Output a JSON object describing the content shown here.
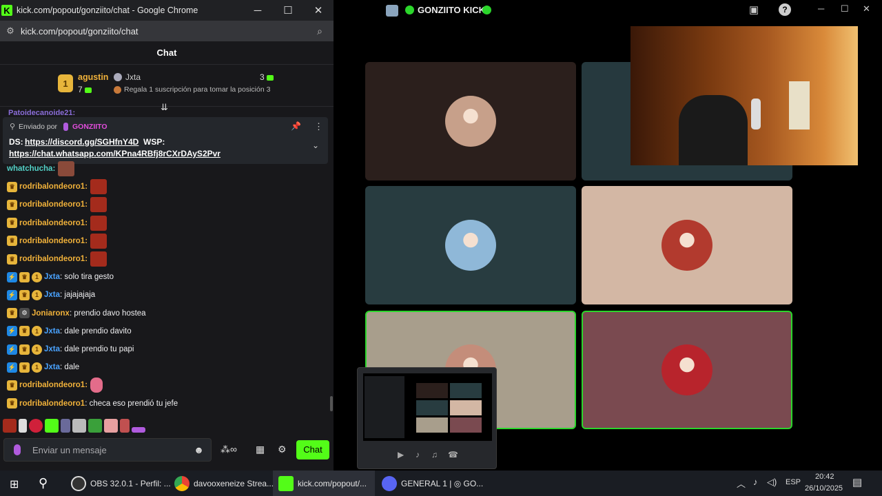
{
  "chrome": {
    "title": "kick.com/popout/gonziito/chat - Google Chrome",
    "url": "kick.com/popout/gonziito/chat",
    "min": "─",
    "max": "☐",
    "close": "✕"
  },
  "chat": {
    "header": "Chat",
    "leaderboard": {
      "first_name": "agustin",
      "first_count": "7",
      "second_name": "Jxta",
      "second_count": "3",
      "position_hint": "Regala 1 suscripción para tomar la posición 3",
      "rank": "1"
    },
    "cut_line": "Patoidecanoide21:",
    "pinned": {
      "sent_by": "Enviado por",
      "author": "GONZIITO",
      "ds_label": "DS:",
      "discord": "https://discord.gg/SGHfnY4D",
      "wsp_label": "WSP:",
      "whatsapp": "https://chat.whatsapp.com/KPna4RBfj8rCXrDAyS2Pvr"
    },
    "messages": [
      {
        "user": "whatchucha:",
        "text": "",
        "color": "#53d1c7",
        "badges": []
      },
      {
        "user": "rodribalondeoro1:",
        "text": "",
        "color": "#f0b13a",
        "badges": [
          "crown"
        ]
      },
      {
        "user": "rodribalondeoro1:",
        "text": "",
        "color": "#f0b13a",
        "badges": [
          "crown"
        ]
      },
      {
        "user": "rodribalondeoro1:",
        "text": "",
        "color": "#f0b13a",
        "badges": [
          "crown"
        ]
      },
      {
        "user": "rodribalondeoro1:",
        "text": "",
        "color": "#f0b13a",
        "badges": [
          "crown"
        ]
      },
      {
        "user": "rodribalondeoro1:",
        "text": "",
        "color": "#f0b13a",
        "badges": [
          "crown"
        ]
      },
      {
        "user": "Jxta",
        "text": ": solo tira gesto",
        "color": "#4aa3ff",
        "badges": [
          "verified",
          "crown",
          "one"
        ]
      },
      {
        "user": "Jxta",
        "text": ": jajajajaja",
        "color": "#4aa3ff",
        "badges": [
          "verified",
          "crown",
          "one"
        ]
      },
      {
        "user": "Joniaronx",
        "text": ": prendio davo hostea",
        "color": "#f0b13a",
        "badges": [
          "crown",
          "bot"
        ]
      },
      {
        "user": "Jxta",
        "text": ": dale prendio davito",
        "color": "#4aa3ff",
        "badges": [
          "verified",
          "crown",
          "one"
        ]
      },
      {
        "user": "Jxta",
        "text": ": dale prendio tu papi",
        "color": "#4aa3ff",
        "badges": [
          "verified",
          "crown",
          "one"
        ]
      },
      {
        "user": "Jxta",
        "text": ": dale",
        "color": "#4aa3ff",
        "badges": [
          "verified",
          "crown",
          "one"
        ]
      },
      {
        "user": "rodribalondeoro1:",
        "text": "",
        "color": "#f0b13a",
        "badges": [
          "crown"
        ]
      },
      {
        "user": "rodribalondeoro1",
        "text": ": checa eso prendió tu jefe",
        "color": "#f0b13a",
        "badges": [
          "crown"
        ]
      }
    ],
    "input_placeholder": "Enviar un mensaje",
    "send_label": "Chat"
  },
  "obs": {
    "title": "GONZIITO KICK",
    "accent": "#2bd62b"
  },
  "call_tiles": [
    {
      "bg": "#2b1f1c",
      "avatar": "#c7a08a"
    },
    {
      "bg": "#26393e",
      "avatar": "#9ab3c7"
    },
    {
      "bg": "#283c40",
      "avatar": "#8fb8d8"
    },
    {
      "bg": "#d3b7a4",
      "avatar": "#b23a2e"
    },
    {
      "bg": "#a89e8c",
      "avatar": "#c48d7a"
    },
    {
      "bg": "#7a4a50",
      "avatar": "#b8242c"
    }
  ],
  "taskbar": {
    "items": [
      "OBS 32.0.1 - Perfil: ...",
      "davooxeneize Strea...",
      "kick.com/popout/...",
      "GENERAL 1 | ◎ GO..."
    ],
    "lang": "ESP",
    "time": "20:42",
    "date": "26/10/2025"
  }
}
